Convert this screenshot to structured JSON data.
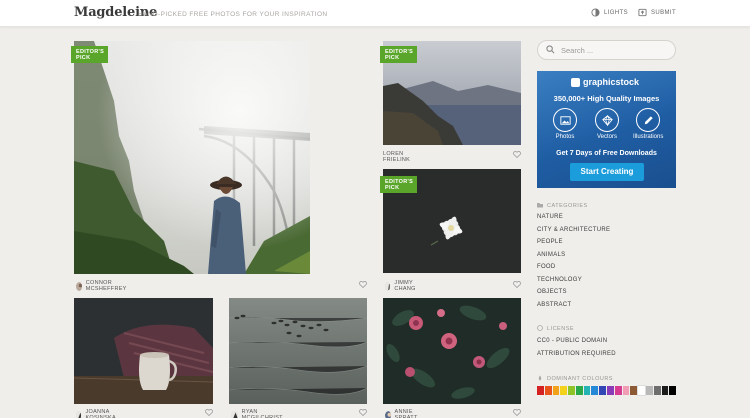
{
  "header": {
    "logo": "Magdeleine",
    "tagline": "HAND-PICKED FREE PHOTOS FOR YOUR INSPIRATION",
    "lights_label": "LIGHTS",
    "submit_label": "SUBMIT"
  },
  "photos": {
    "bridge": {
      "badge": "EDITOR'S PICK",
      "author": "CONNOR MCSHEFFREY"
    },
    "coast": {
      "badge": "EDITOR'S PICK",
      "author": "LOREN FRIELINK"
    },
    "flower": {
      "badge": "EDITOR'S PICK",
      "author": "JIMMY CHANG"
    },
    "mug": {
      "author": "JOANNA KOSINSKA"
    },
    "ducks": {
      "author": "RYAN MCGILCHRIST"
    },
    "roses": {
      "author": "ANNIE SPRATT"
    }
  },
  "sidebar": {
    "search_placeholder": "Search ...",
    "ad": {
      "brand": "graphicstock",
      "headline": "350,000+ High Quality Images",
      "features": [
        "Photos",
        "Vectors",
        "Illustrations"
      ],
      "offer": "Get 7 Days of Free Downloads",
      "cta": "Start Creating"
    },
    "categories_title": "CATEGORIES",
    "categories": [
      "NATURE",
      "CITY & ARCHITECTURE",
      "PEOPLE",
      "ANIMALS",
      "FOOD",
      "TECHNOLOGY",
      "OBJECTS",
      "ABSTRACT"
    ],
    "license_title": "LICENSE",
    "licenses": [
      "CC0 - PUBLIC DOMAIN",
      "ATTRIBUTION REQUIRED"
    ],
    "colours_title": "DOMINANT COLOURS",
    "colours": [
      "#d42121",
      "#e8541c",
      "#f2a21a",
      "#f4d21b",
      "#8fc427",
      "#2aa84a",
      "#26b3b3",
      "#2589d8",
      "#3346b5",
      "#8a3cb8",
      "#d63c92",
      "#f09db5",
      "#8c5a34",
      "#ffffff",
      "#b8b8b8",
      "#6e6e6e",
      "#1c1c1c",
      "#000000"
    ]
  }
}
